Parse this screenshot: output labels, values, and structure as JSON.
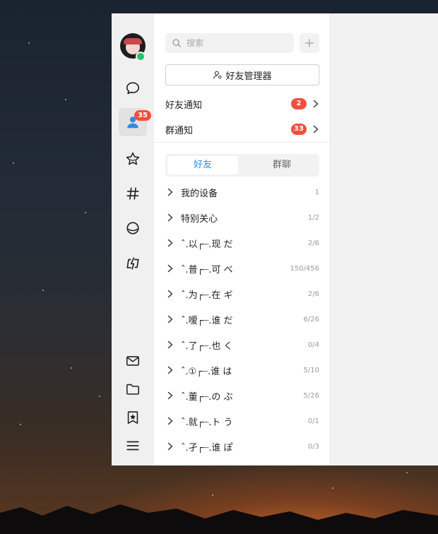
{
  "rail": {
    "contacts_badge": "35",
    "colors": {
      "badge": "#f04e3e",
      "online": "#25c26e",
      "contacts_active": "#2e8ae6"
    }
  },
  "search": {
    "placeholder": "搜索"
  },
  "friend_manager_label": "好友管理器",
  "notifications": [
    {
      "label": "好友通知",
      "count": "2"
    },
    {
      "label": "群通知",
      "count": "33"
    }
  ],
  "tabs": {
    "friends": "好友",
    "groups": "群聊"
  },
  "groups": [
    {
      "name": "我的设备",
      "count": "1"
    },
    {
      "name": "特别关心",
      "count": "1/2"
    },
    {
      "name": "ˆ.以┌┈.现 だ",
      "count": "2/6"
    },
    {
      "name": "ˆ.普┌┈.可 ベ",
      "count": "150/456"
    },
    {
      "name": "ˆ.为┌┈.在 ギ",
      "count": "2/6"
    },
    {
      "name": "ˆ.嗳┌┈.谁 だ",
      "count": "6/26"
    },
    {
      "name": "ˆ.了┌┈.也 く",
      "count": "0/4"
    },
    {
      "name": "ˆ.①┌┈.谁 は",
      "count": "5/10"
    },
    {
      "name": "ˆ.董┌┈.の ぶ",
      "count": "5/26"
    },
    {
      "name": "ˆ.就┌┈.ト う",
      "count": "0/1"
    },
    {
      "name": "ˆ.孑┌┈.谁 ぽ",
      "count": "0/3"
    }
  ]
}
